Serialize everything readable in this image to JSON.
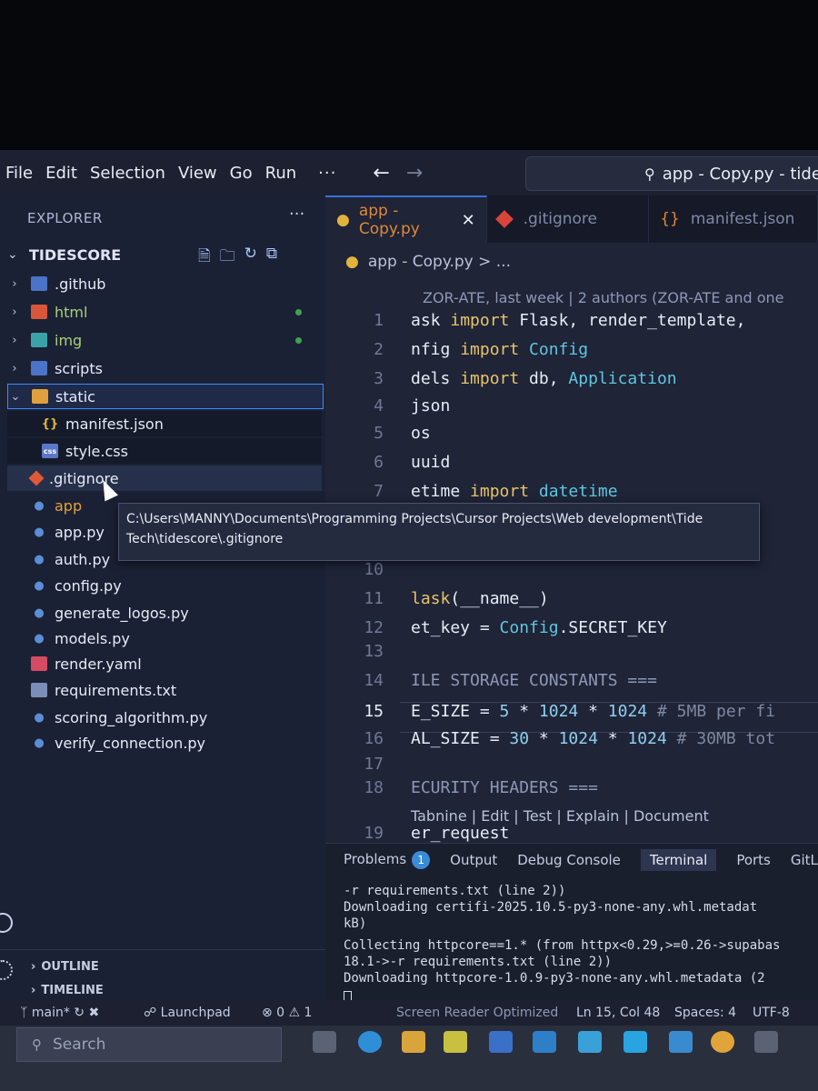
{
  "menu": {
    "items": [
      "File",
      "Edit",
      "Selection",
      "View",
      "Go",
      "Run"
    ],
    "more": "···",
    "back_glyph": "←",
    "forward_glyph": "→",
    "command_center": "app - Copy.py - tides"
  },
  "explorer": {
    "title": "EXPLORER",
    "more": "···",
    "root": "TIDESCORE",
    "items": [
      {
        "label": ".github",
        "icon": "folder-github-icon",
        "kind": "folder"
      },
      {
        "label": "html",
        "icon": "folder-html-icon",
        "kind": "folder"
      },
      {
        "label": "img",
        "icon": "folder-img-icon",
        "kind": "folder"
      },
      {
        "label": "scripts",
        "icon": "folder-scripts-icon",
        "kind": "folder"
      },
      {
        "label": "static",
        "icon": "folder-open-icon",
        "kind": "folder-open"
      },
      {
        "label": "manifest.json",
        "icon": "json-icon",
        "kind": "file"
      },
      {
        "label": "style.css",
        "icon": "css-icon",
        "kind": "file"
      },
      {
        "label": ".gitignore",
        "icon": "git-icon",
        "kind": "file"
      },
      {
        "label": "app",
        "icon": "python-icon",
        "kind": "file"
      },
      {
        "label": "app.py",
        "icon": "python-icon",
        "kind": "file"
      },
      {
        "label": "auth.py",
        "icon": "python-icon",
        "kind": "file"
      },
      {
        "label": "config.py",
        "icon": "python-icon",
        "kind": "file"
      },
      {
        "label": "generate_logos.py",
        "icon": "python-icon",
        "kind": "file"
      },
      {
        "label": "models.py",
        "icon": "python-icon",
        "kind": "file"
      },
      {
        "label": "render.yaml",
        "icon": "yaml-icon",
        "kind": "file"
      },
      {
        "label": "requirements.txt",
        "icon": "txt-icon",
        "kind": "file"
      },
      {
        "label": "scoring_algorithm.py",
        "icon": "python-icon",
        "kind": "file"
      },
      {
        "label": "verify_connection.py",
        "icon": "python-icon",
        "kind": "file"
      }
    ],
    "outline": "OUTLINE",
    "timeline": "TIMELINE"
  },
  "tooltip": {
    "line1": "C:\\Users\\MANNY\\Documents\\Programming Projects\\Cursor Projects\\Web development\\Tide",
    "line2": "Tech\\tidescore\\.gitignore"
  },
  "tabs": [
    {
      "label": "app - Copy.py",
      "active": true,
      "close": "✕"
    },
    {
      "label": ".gitignore",
      "active": false
    },
    {
      "label": "manifest.json",
      "active": false
    }
  ],
  "breadcrumb": {
    "file": "app - Copy.py",
    "trail": "> ..."
  },
  "editor": {
    "blame": "ZOR-ATE, last week | 2 authors (ZOR-ATE and one",
    "codelens": "Tabnine | Edit | Test | Explain | Document",
    "lines": [
      {
        "n": "1",
        "parts": [
          [
            "id",
            "ask "
          ],
          [
            "kw",
            "import "
          ],
          [
            "id",
            "Flask, render_template,"
          ]
        ]
      },
      {
        "n": "2",
        "parts": [
          [
            "id",
            "nfig "
          ],
          [
            "kw",
            "import "
          ],
          [
            "cls",
            "Config"
          ]
        ]
      },
      {
        "n": "3",
        "parts": [
          [
            "id",
            "dels "
          ],
          [
            "kw",
            "import "
          ],
          [
            "id",
            "db, "
          ],
          [
            "cls",
            "Application"
          ]
        ]
      },
      {
        "n": "4",
        "parts": [
          [
            "id",
            "json"
          ]
        ]
      },
      {
        "n": "5",
        "parts": [
          [
            "id",
            "os"
          ]
        ]
      },
      {
        "n": "6",
        "parts": [
          [
            "id",
            "uuid"
          ]
        ]
      },
      {
        "n": "7",
        "parts": [
          [
            "id",
            "etime "
          ],
          [
            "kw",
            "import "
          ],
          [
            "cls",
            "datetime"
          ]
        ]
      },
      {
        "n": "10",
        "parts": []
      },
      {
        "n": "11",
        "parts": [
          [
            "kw",
            "lask"
          ],
          [
            "id",
            "(__name__)"
          ]
        ]
      },
      {
        "n": "12",
        "parts": [
          [
            "id",
            "et_key = "
          ],
          [
            "cls",
            "Config"
          ],
          [
            "id",
            ".SECRET_KEY"
          ]
        ]
      },
      {
        "n": "13",
        "parts": []
      },
      {
        "n": "14",
        "parts": [
          [
            "hdr",
            "ILE STORAGE CONSTANTS ==="
          ]
        ]
      },
      {
        "n": "15",
        "parts": [
          [
            "id",
            "E_SIZE = "
          ],
          [
            "num",
            "5"
          ],
          [
            "id",
            " * "
          ],
          [
            "num",
            "1024"
          ],
          [
            "id",
            " * "
          ],
          [
            "num",
            "1024"
          ],
          [
            "cmt",
            "  # 5MB per fi"
          ]
        ]
      },
      {
        "n": "16",
        "parts": [
          [
            "id",
            "AL_SIZE = "
          ],
          [
            "num",
            "30"
          ],
          [
            "id",
            " * "
          ],
          [
            "num",
            "1024"
          ],
          [
            "id",
            " * "
          ],
          [
            "num",
            "1024"
          ],
          [
            "cmt",
            "  # 30MB tot"
          ]
        ]
      },
      {
        "n": "17",
        "parts": []
      },
      {
        "n": "18",
        "parts": [
          [
            "hdr",
            "ECURITY HEADERS ==="
          ]
        ]
      },
      {
        "n": "19",
        "parts": [
          [
            "id",
            "er_request"
          ]
        ]
      }
    ]
  },
  "panel": {
    "tabs": [
      "Problems",
      "Output",
      "Debug Console",
      "Terminal",
      "Ports",
      "GitL"
    ],
    "problems_badge": "1",
    "terminal_lines": [
      "-r requirements.txt (line 2))",
      "  Downloading certifi-2025.10.5-py3-none-any.whl.metadat",
      " kB)",
      "Collecting httpcore==1.* (from httpx<0.29,>=0.26->supabas",
      "18.1->-r requirements.txt (line 2))",
      "  Downloading httpcore-1.0.9-py3-none-any.whl.metadata (2"
    ]
  },
  "status": {
    "branch": "main*",
    "launchpad": "Launchpad",
    "errors": "⊗ 0",
    "warnings": "⚠ 1",
    "screen_reader": "Screen Reader Optimized",
    "position": "Ln 15, Col 48",
    "spaces": "Spaces: 4",
    "encoding": "UTF-8"
  },
  "taskbar": {
    "search_placeholder": "Search"
  }
}
